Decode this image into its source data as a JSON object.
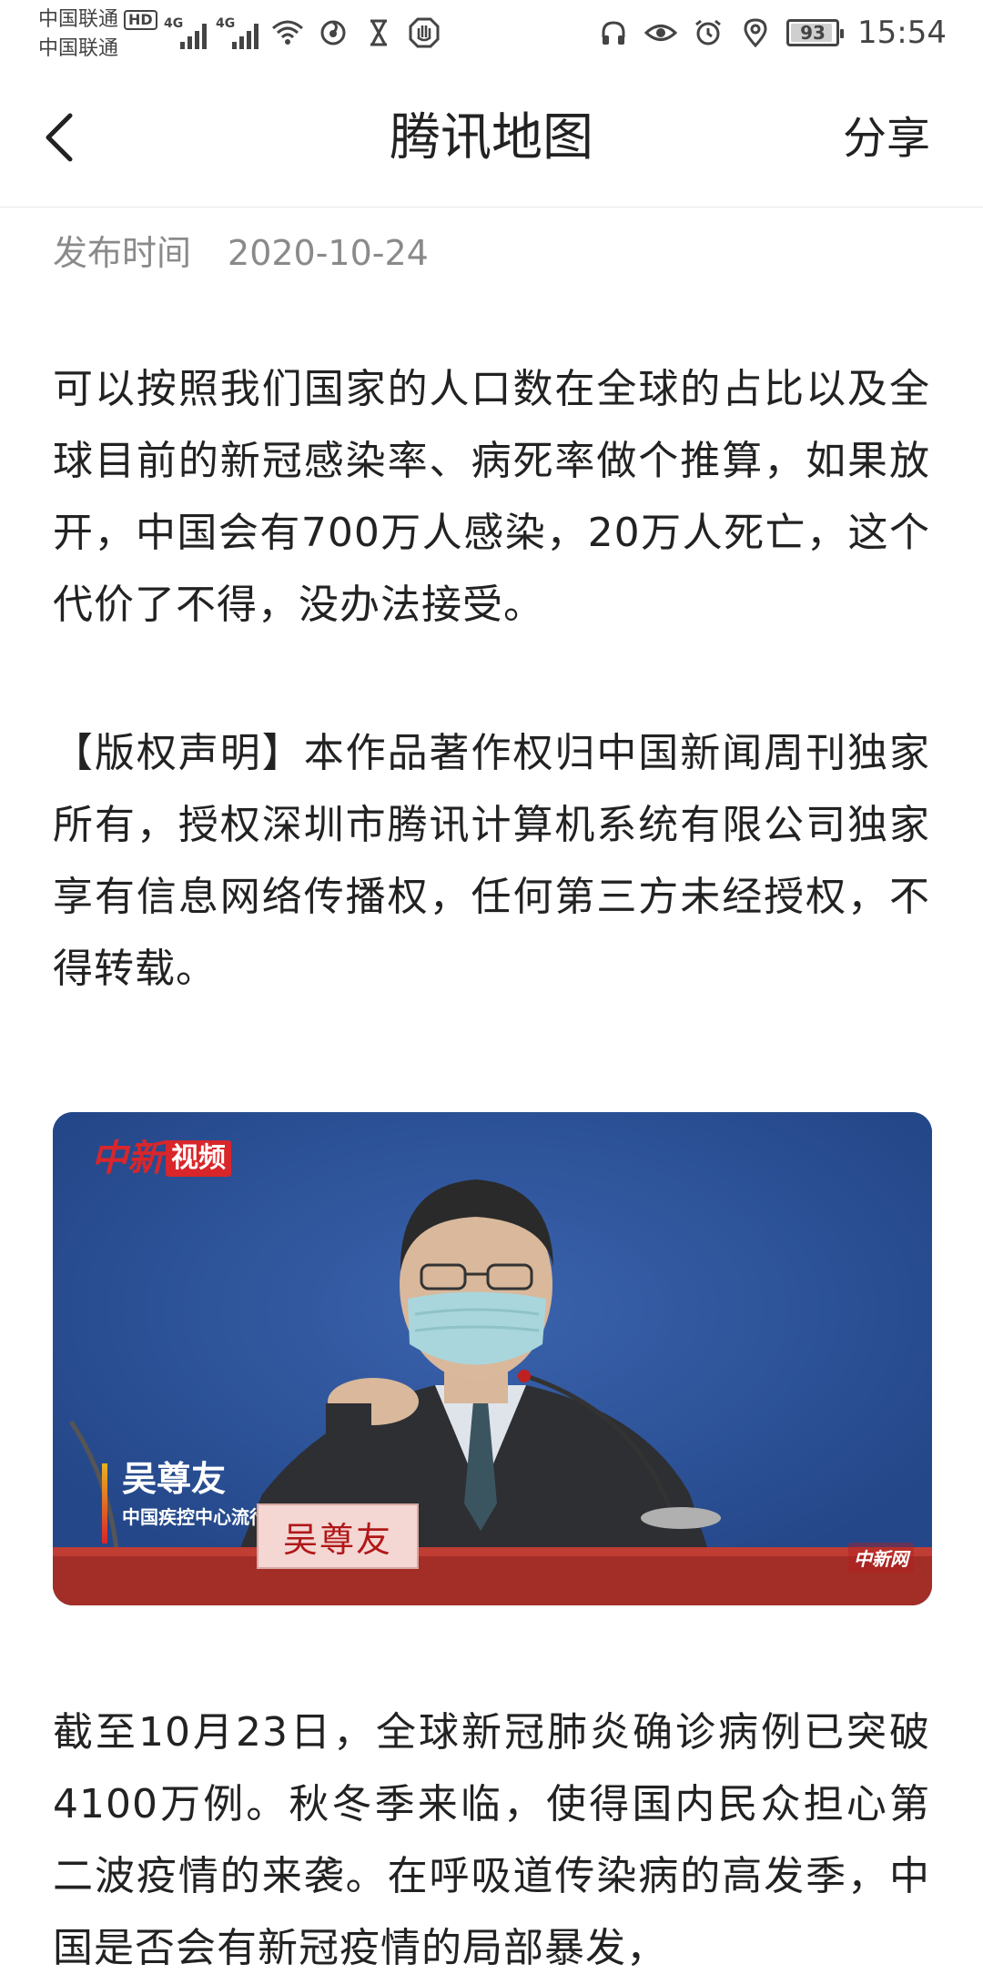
{
  "status_bar": {
    "carrier_primary": "中国联通",
    "carrier_secondary": "中国联通",
    "hd_label": "HD",
    "signal_label_1": "4G",
    "signal_label_2": "4G",
    "battery_percent": 93,
    "battery_text": "93",
    "time": "15:54",
    "left_icons": [
      "wifi-icon",
      "swirl-icon",
      "hourglass-icon",
      "hand-icon"
    ],
    "right_icons": [
      "headphones-icon",
      "eye-icon",
      "alarm-icon",
      "location-icon"
    ]
  },
  "nav": {
    "title": "腾讯地图",
    "share_label": "分享",
    "back_icon": "chevron-left-icon"
  },
  "article": {
    "publish_label": "发布时间",
    "publish_date": "2020-10-24",
    "paragraph_1": "可以按照我们国家的人口数在全球的占比以及全球目前的新冠感染率、病死率做个推算，如果放开，中国会有700万人感染，20万人死亡，这个代价了不得，没办法接受。",
    "paragraph_2": "【版权声明】本作品著作权归中国新闻周刊独家所有，授权深圳市腾讯计算机系统有限公司独家享有信息网络传播权，任何第三方未经授权，不得转载。",
    "video": {
      "brand_red": "中新",
      "brand_box": "视频",
      "person_name": "吴尊友",
      "person_title": "中国疾控中心流行病学首席专家",
      "nameplate": "吴尊友",
      "corner_logo": "中新网"
    },
    "paragraph_3": "截至10月23日，全球新冠肺炎确诊病例已突破4100万例。秋冬季来临，使得国内民众担心第二波疫情的来袭。在呼吸道传染病的高发季，中国是否会有新冠疫情的局部暴发，"
  }
}
